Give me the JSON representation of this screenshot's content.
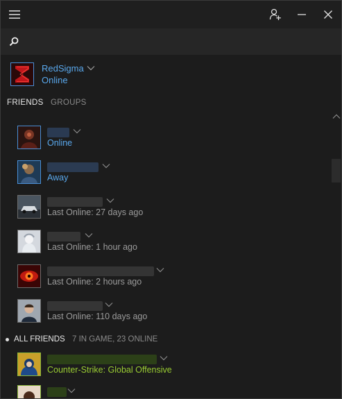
{
  "titlebar": {
    "menu_icon": "hamburger-icon",
    "add_friend_icon": "add-friend-icon",
    "minimize_icon": "minimize-icon",
    "close_icon": "close-icon"
  },
  "search": {
    "value": "",
    "placeholder": "",
    "icon": "search-icon"
  },
  "me": {
    "name": "RedSigma",
    "status": "Online"
  },
  "tabs": [
    {
      "label": "FRIENDS",
      "active": true
    },
    {
      "label": "GROUPS",
      "active": false
    }
  ],
  "friends": [
    {
      "status": "Online",
      "state": "online"
    },
    {
      "status": "Away",
      "state": "online"
    },
    {
      "status": "Last Online: 27 days ago",
      "state": "offline"
    },
    {
      "status": "Last Online: 1 hour ago",
      "state": "offline"
    },
    {
      "status": "Last Online: 2 hours ago",
      "state": "offline"
    },
    {
      "status": "Last Online: 110 days ago",
      "state": "offline"
    }
  ],
  "all_friends": {
    "title": "ALL FRIENDS",
    "counts": "7 IN GAME, 23 ONLINE",
    "items": [
      {
        "status": "Counter-Strike: Global Offensive",
        "state": "ingame"
      },
      {
        "status": "",
        "state": "ingame"
      }
    ]
  },
  "colors": {
    "online": "#5aa9ee",
    "offline": "#9b9b9b",
    "ingame": "#9acd32",
    "background": "#1c1c1c"
  }
}
